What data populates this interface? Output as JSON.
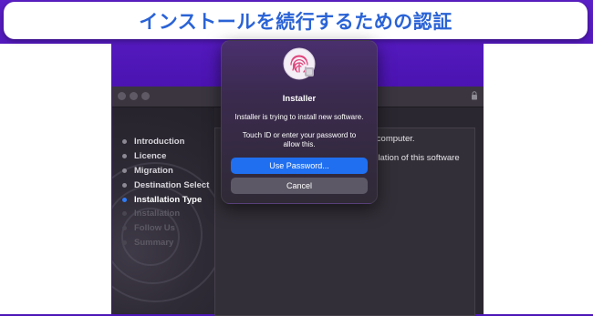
{
  "banner": {
    "text": "インストールを続行するための認証"
  },
  "sidebar": {
    "steps": [
      {
        "label": "Introduction",
        "state": "done"
      },
      {
        "label": "Licence",
        "state": "done"
      },
      {
        "label": "Migration",
        "state": "done"
      },
      {
        "label": "Destination Select",
        "state": "done"
      },
      {
        "label": "Installation Type",
        "state": "current"
      },
      {
        "label": "Installation",
        "state": "future"
      },
      {
        "label": "Follow Us",
        "state": "future"
      },
      {
        "label": "Summary",
        "state": "future"
      }
    ]
  },
  "content": {
    "line1": "r computer.",
    "line2": "allation of this software"
  },
  "dialog": {
    "title": "Installer",
    "message": "Installer is trying to install new software.",
    "hint": "Touch ID or enter your password to allow this.",
    "primary_button": "Use Password...",
    "cancel_button": "Cancel"
  },
  "colors": {
    "backdrop": "#4a12b0",
    "banner_text": "#2a63d6",
    "primary_button": "#1f6ff0",
    "current_step_dot": "#2f7cf6"
  },
  "icons": {
    "dialog": "fingerprint-icon",
    "titlebar": "lock-icon"
  }
}
